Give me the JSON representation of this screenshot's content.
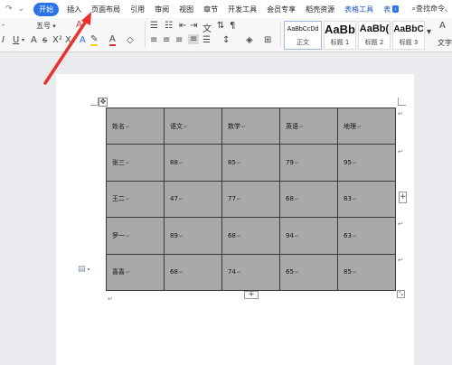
{
  "menubar": {
    "quick_icons": [
      "redo-icon",
      "more-icon"
    ],
    "items": [
      "开始",
      "插入",
      "页面布局",
      "引用",
      "审阅",
      "视图",
      "章节",
      "开发工具",
      "会员专享",
      "稻壳资源"
    ],
    "active": "开始",
    "tool_tab": "表格工具",
    "tool_tab_more": "表",
    "search": "查找命令、"
  },
  "ribbon": {
    "font_size": "五号",
    "styles": [
      {
        "sample": "AaBbCcDd",
        "name": "正文"
      },
      {
        "sample": "AaBb",
        "name": "标题 1"
      },
      {
        "sample": "AaBb(",
        "name": "标题 2"
      },
      {
        "sample": "AaBbC",
        "name": "标题 3"
      }
    ],
    "text_tool": "文字"
  },
  "table": {
    "rows": [
      [
        "姓名",
        "语文",
        "数学",
        "英语",
        "地理"
      ],
      [
        "张三",
        "88",
        "85",
        "79",
        "95"
      ],
      [
        "王二",
        "47",
        "77",
        "68",
        "83"
      ],
      [
        "罗一",
        "89",
        "68",
        "94",
        "63"
      ],
      [
        "喜喜",
        "68",
        "74",
        "65",
        "85"
      ]
    ]
  },
  "colors": {
    "accent": "#2b73e8",
    "tool_tab": "#1a57b8",
    "table_fill": "#a9a9a9",
    "arrow": "#e8322b"
  }
}
